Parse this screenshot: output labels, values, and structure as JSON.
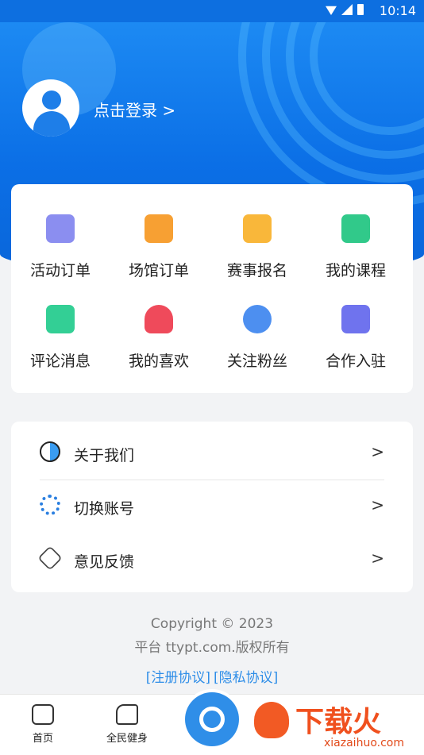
{
  "status_bar": {
    "time": "10:14"
  },
  "profile": {
    "login_text": "点击登录 >"
  },
  "grid": {
    "items": [
      {
        "label": "活动订单",
        "icon": "clipboard-purple-icon",
        "color": "#8b8ef0"
      },
      {
        "label": "场馆订单",
        "icon": "shop-orange-icon",
        "color": "#f7a033"
      },
      {
        "label": "赛事报名",
        "icon": "trend-clipboard-icon",
        "color": "#f9b73a"
      },
      {
        "label": "我的课程",
        "icon": "document-green-icon",
        "color": "#31c98a"
      },
      {
        "label": "评论消息",
        "icon": "chat-green-icon",
        "color": "#33cf95"
      },
      {
        "label": "我的喜欢",
        "icon": "heart-icon",
        "color": "#ef4a5b"
      },
      {
        "label": "关注粉丝",
        "icon": "user-check-icon",
        "color": "#4d8ff0"
      },
      {
        "label": "合作入驻",
        "icon": "handshake-icon",
        "color": "#6f73ee"
      }
    ]
  },
  "menu": {
    "items": [
      {
        "label": "关于我们",
        "icon": "clock-icon"
      },
      {
        "label": "切换账号",
        "icon": "gear-icon"
      },
      {
        "label": "意见反馈",
        "icon": "badge-icon"
      }
    ]
  },
  "footer": {
    "copyright_line1": "Copyright © 2023",
    "copyright_line2": "平台 ttypt.com.版权所有",
    "register_link": "[注册协议]",
    "privacy_link": "[隐私协议]"
  },
  "tabs": {
    "home": "首页",
    "fitness": "全民健身"
  },
  "watermark": {
    "brand": "下载火",
    "url": "xiazaihuo.com"
  }
}
